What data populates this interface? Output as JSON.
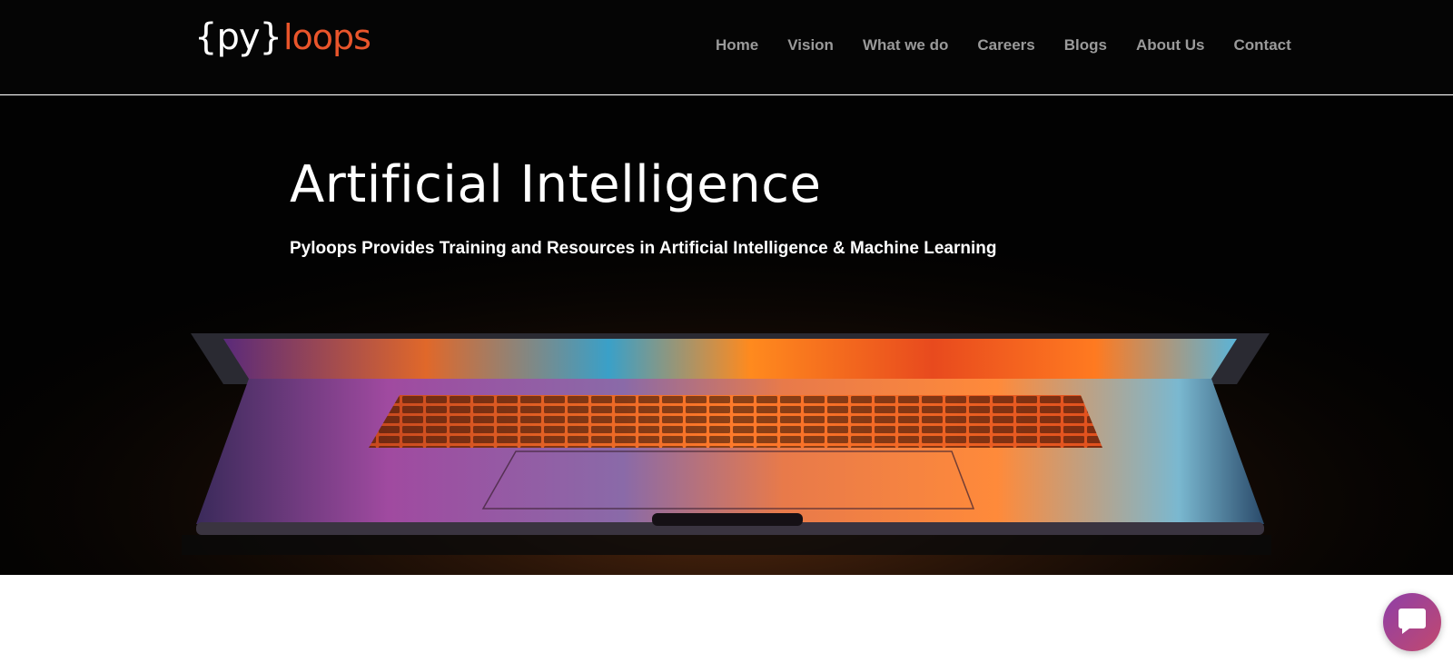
{
  "brand": {
    "logo_py": "{py}",
    "logo_loops": "loops"
  },
  "nav": {
    "items": [
      "Home",
      "Vision",
      "What we do",
      "Careers",
      "Blogs",
      "About Us",
      "Contact"
    ]
  },
  "hero": {
    "title": "Artificial Intelligence",
    "subtitle": "Pyloops Provides Training and Resources in Artificial Intelligence & Machine Learning"
  },
  "colors": {
    "accent": "#e9552b",
    "nav_text": "#9a9a9a",
    "chat_start": "#8e3fa8",
    "chat_end": "#c2496e"
  },
  "icons": {
    "chat": "chat-bubble-icon"
  }
}
